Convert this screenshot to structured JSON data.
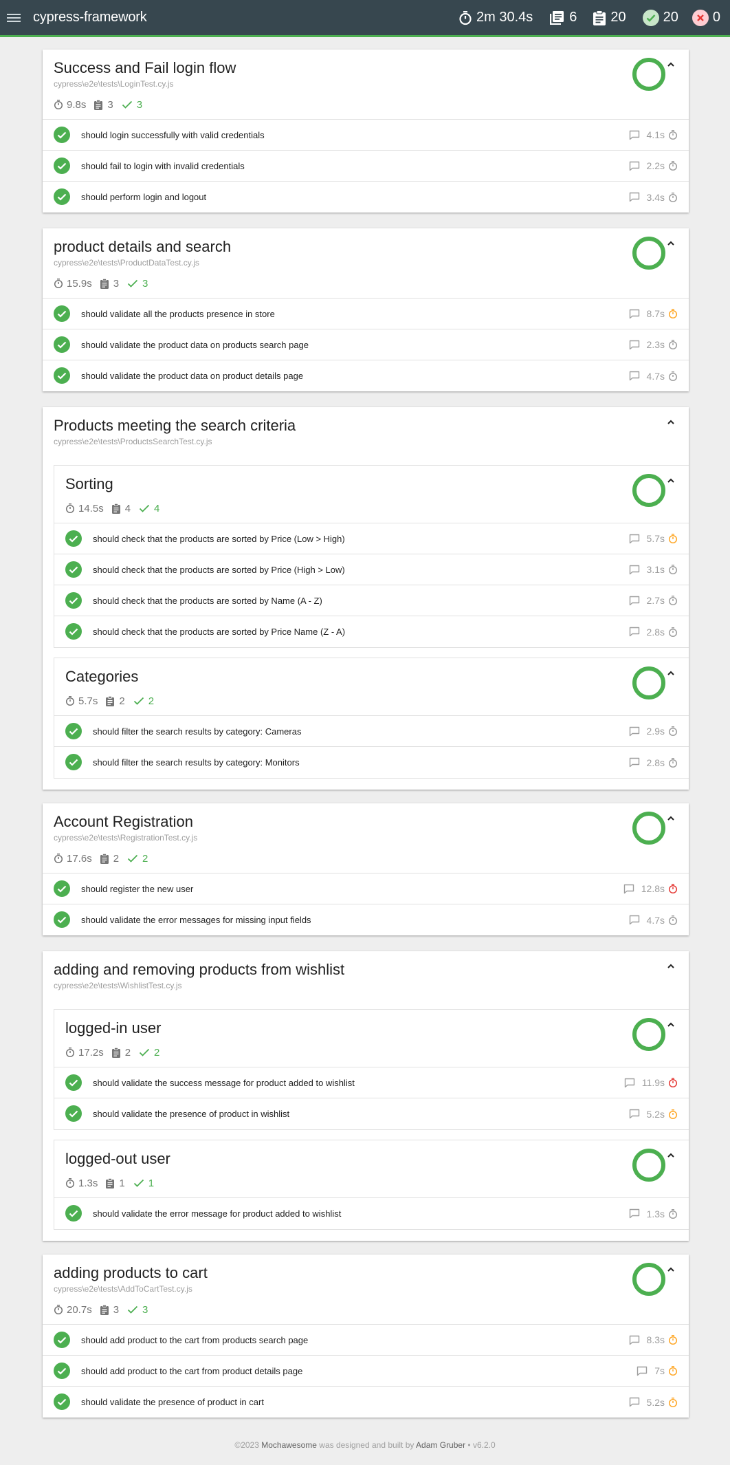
{
  "nav": {
    "title": "cypress-framework",
    "duration": "2m 30.4s",
    "suites": "6",
    "tests": "20",
    "passed": "20",
    "failed": "0"
  },
  "colors": {
    "pass": "#4caf50",
    "slow": "#ffa726",
    "verySlow": "#e53935",
    "navbar": "#37474f"
  },
  "suites": [
    {
      "title": "Success and Fail login flow",
      "file": "cypress\\e2e\\tests\\LoginTest.cy.js",
      "duration": "9.8s",
      "tests": "3",
      "passes": "3",
      "items": [
        {
          "title": "should login successfully with valid credentials",
          "duration": "4.1s",
          "speed": "fast"
        },
        {
          "title": "should fail to login with invalid credentials",
          "duration": "2.2s",
          "speed": "fast"
        },
        {
          "title": "should perform login and logout",
          "duration": "3.4s",
          "speed": "fast"
        }
      ]
    },
    {
      "title": "product details and search",
      "file": "cypress\\e2e\\tests\\ProductDataTest.cy.js",
      "duration": "15.9s",
      "tests": "3",
      "passes": "3",
      "items": [
        {
          "title": "should validate all the products presence in store",
          "duration": "8.7s",
          "speed": "medium"
        },
        {
          "title": "should validate the product data on products search page",
          "duration": "2.3s",
          "speed": "fast"
        },
        {
          "title": "should validate the product data on product details page",
          "duration": "4.7s",
          "speed": "fast"
        }
      ]
    },
    {
      "title": "Products meeting the search criteria",
      "file": "cypress\\e2e\\tests\\ProductsSearchTest.cy.js",
      "children": [
        {
          "title": "Sorting",
          "duration": "14.5s",
          "tests": "4",
          "passes": "4",
          "items": [
            {
              "title": "should check that the products are sorted by Price (Low > High)",
              "duration": "5.7s",
              "speed": "medium"
            },
            {
              "title": "should check that the products are sorted by Price (High > Low)",
              "duration": "3.1s",
              "speed": "fast"
            },
            {
              "title": "should check that the products are sorted by Name (A - Z)",
              "duration": "2.7s",
              "speed": "fast"
            },
            {
              "title": "should check that the products are sorted by Price Name (Z - A)",
              "duration": "2.8s",
              "speed": "fast"
            }
          ]
        },
        {
          "title": "Categories",
          "duration": "5.7s",
          "tests": "2",
          "passes": "2",
          "items": [
            {
              "title": "should filter the search results by category: Cameras",
              "duration": "2.9s",
              "speed": "fast"
            },
            {
              "title": "should filter the search results by category: Monitors",
              "duration": "2.8s",
              "speed": "fast"
            }
          ]
        }
      ]
    },
    {
      "title": "Account Registration",
      "file": "cypress\\e2e\\tests\\RegistrationTest.cy.js",
      "duration": "17.6s",
      "tests": "2",
      "passes": "2",
      "items": [
        {
          "title": "should register the new user",
          "duration": "12.8s",
          "speed": "slow"
        },
        {
          "title": "should validate the error messages for missing input fields",
          "duration": "4.7s",
          "speed": "fast"
        }
      ]
    },
    {
      "title": "adding and removing products from wishlist",
      "file": "cypress\\e2e\\tests\\WishlistTest.cy.js",
      "children": [
        {
          "title": "logged-in user",
          "duration": "17.2s",
          "tests": "2",
          "passes": "2",
          "items": [
            {
              "title": "should validate the success message for product added to wishlist",
              "duration": "11.9s",
              "speed": "slow"
            },
            {
              "title": "should validate the presence of product in wishlist",
              "duration": "5.2s",
              "speed": "medium"
            }
          ]
        },
        {
          "title": "logged-out user",
          "duration": "1.3s",
          "tests": "1",
          "passes": "1",
          "items": [
            {
              "title": "should validate the error message for product added to wishlist",
              "duration": "1.3s",
              "speed": "fast"
            }
          ]
        }
      ]
    },
    {
      "title": "adding products to cart",
      "file": "cypress\\e2e\\tests\\AddToCartTest.cy.js",
      "duration": "20.7s",
      "tests": "3",
      "passes": "3",
      "items": [
        {
          "title": "should add product to the cart from products search page",
          "duration": "8.3s",
          "speed": "medium"
        },
        {
          "title": "should add product to the cart from product details page",
          "duration": "7s",
          "speed": "medium"
        },
        {
          "title": "should validate the presence of product in cart",
          "duration": "5.2s",
          "speed": "medium"
        }
      ]
    }
  ],
  "footer": {
    "prefix": "©2023 ",
    "brand": "Mochawesome",
    "middle": " was designed and built by ",
    "author": "Adam Gruber",
    "version": " • v6.2.0"
  }
}
